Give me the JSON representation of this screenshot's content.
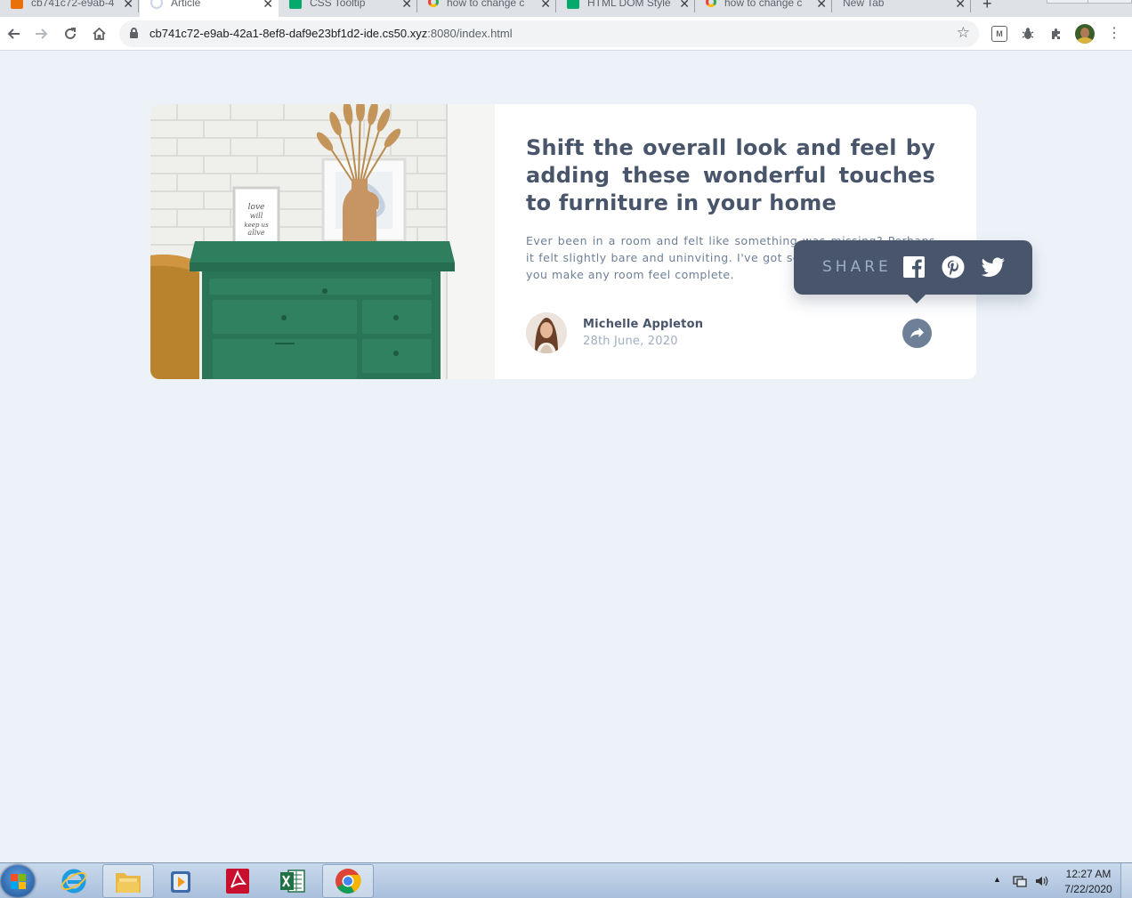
{
  "browser": {
    "tabs": [
      {
        "title": "cb741c72-e9ab-4",
        "favicon": "box-icon",
        "active": false
      },
      {
        "title": "Article",
        "favicon": "article-icon",
        "active": true
      },
      {
        "title": "CSS Tooltip",
        "favicon": "w3schools-icon",
        "active": false
      },
      {
        "title": "how to change c",
        "favicon": "google-icon",
        "active": false
      },
      {
        "title": "HTML DOM Style",
        "favicon": "w3schools-icon",
        "active": false
      },
      {
        "title": "how to change c",
        "favicon": "google-icon",
        "active": false
      },
      {
        "title": "New Tab",
        "favicon": "",
        "active": false
      }
    ],
    "new_tab_label": "+",
    "url_host": "cb741c72-e9ab-42a1-8ef8-daf9e23bf1d2-ide.cs50.xyz",
    "url_rest": ":8080/index.html"
  },
  "article": {
    "headline": "Shift the overall look and feel by adding these wonderful touches to furniture in your home",
    "excerpt": "Ever been in a room and felt like something was missing? Perhaps it felt slightly bare and uninviting. I've got some simple tips to help you make any room feel complete.",
    "image_alt": "Green dresser with framed print and vase of dried grass",
    "author": {
      "name": "Michelle Appleton",
      "date": "28th June, 2020"
    }
  },
  "share": {
    "label": "SHARE",
    "networks": [
      "facebook",
      "pinterest",
      "twitter"
    ]
  },
  "colors": {
    "page_bg": "#ecf2f8",
    "card_bg": "#ffffff",
    "headline": "#48556a",
    "body_text": "#6e8098",
    "muted": "#9eafc2",
    "tooltip_bg": "#48556a"
  },
  "taskbar": {
    "apps": [
      "internet-explorer",
      "file-explorer",
      "media-player",
      "adobe-reader",
      "excel",
      "chrome"
    ],
    "time": "12:27 AM",
    "date": "7/22/2020"
  }
}
